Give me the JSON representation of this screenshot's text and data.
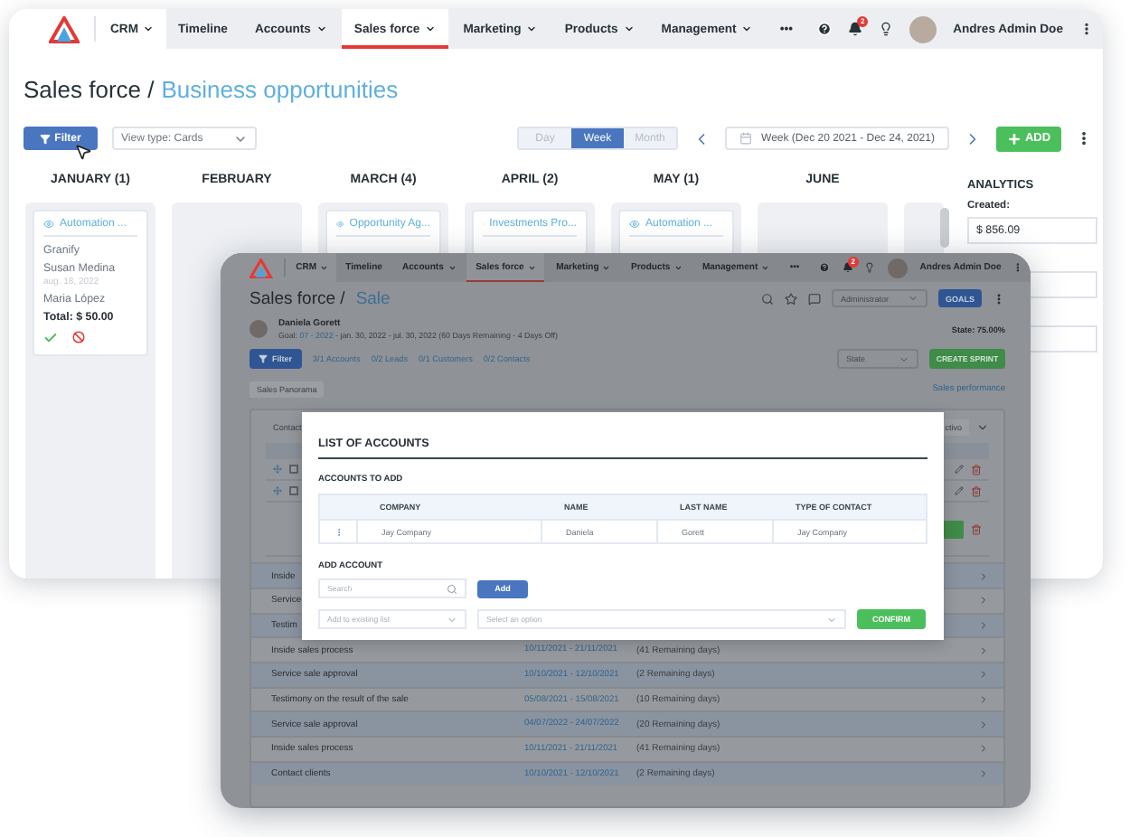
{
  "back_window": {
    "nav": {
      "menu": "CRM",
      "tabs": [
        {
          "label": "Timeline",
          "caret": false,
          "selected": false
        },
        {
          "label": "Accounts",
          "caret": true,
          "selected": false
        },
        {
          "label": "Sales force",
          "caret": true,
          "selected": true
        },
        {
          "label": "Marketing",
          "caret": true,
          "selected": false
        },
        {
          "label": "Products",
          "caret": true,
          "selected": false
        },
        {
          "label": "Management",
          "caret": true,
          "selected": false
        },
        {
          "label": "•••",
          "caret": false,
          "selected": false
        }
      ],
      "badge": "2",
      "user": "Andres Admin Doe"
    },
    "title": {
      "section": "Sales force /",
      "page": "Business opportunities"
    },
    "toolbar": {
      "filter": "Filter",
      "view_type": "View type: Cards",
      "ranges": [
        {
          "label": "Day",
          "selected": false
        },
        {
          "label": "Week",
          "selected": true
        },
        {
          "label": "Month",
          "selected": false
        }
      ],
      "date_range": "Week (Dec 20 2021 - Dec 24, 2021)",
      "add": "ADD"
    },
    "months": [
      {
        "header": "JANUARY (1)",
        "cards": [
          {
            "title": "Automation ...",
            "lines": [
              {
                "kind": "company",
                "text": "Granify"
              },
              {
                "kind": "contact",
                "text": "Susan Medina"
              },
              {
                "kind": "date",
                "text": "aug. 18, 2022"
              },
              {
                "kind": "contact",
                "text": "Maria López"
              },
              {
                "kind": "total",
                "text": "Total: $ 50.00"
              }
            ],
            "actions": true
          }
        ]
      },
      {
        "header": "FEBRUARY"
      },
      {
        "header": "MARCH (4)",
        "cards": [
          {
            "title": "Opportunity Ag...",
            "actions": false
          }
        ]
      },
      {
        "header": "APRIL (2)",
        "cards": [
          {
            "title": "Investments Pro...",
            "actions": false
          }
        ]
      },
      {
        "header": "MAY (1)",
        "cards": [
          {
            "title": "Automation ...",
            "actions": false
          }
        ]
      },
      {
        "header": "JUNE"
      }
    ],
    "analytics": {
      "title": "ANALYTICS",
      "created_label": "Created:",
      "created_value": "$ 856.09"
    }
  },
  "front_window": {
    "nav": {
      "menu": "CRM",
      "tabs": [
        {
          "label": "Timeline",
          "caret": false,
          "selected": false
        },
        {
          "label": "Accounts",
          "caret": true,
          "selected": false
        },
        {
          "label": "Sales force",
          "caret": true,
          "selected": true
        },
        {
          "label": "Marketing",
          "caret": true,
          "selected": false
        },
        {
          "label": "Products",
          "caret": true,
          "selected": false
        },
        {
          "label": "Management",
          "caret": true,
          "selected": false
        },
        {
          "label": "•••",
          "caret": false,
          "selected": false
        }
      ],
      "badge": "2",
      "user": "Andres Admin Doe"
    },
    "title": {
      "section": "Sales force /",
      "page": "Sale"
    },
    "role_select": "Administrator",
    "goals": "GOALS",
    "owner": {
      "name": "Daniela Gorett",
      "goal_label": "Goal:",
      "goal_link": "07 - 2022",
      "goal_rest": "- jan. 30, 2022 - jul. 30, 2022  (60 Days Remaining - 4 Days Off)"
    },
    "state": "State: 75.00%",
    "filter": "Filter",
    "counters": [
      "3/1 Accounts",
      "0/2 Leads",
      "0/1 Customers",
      "0/2 Contacts"
    ],
    "state_select": "State",
    "create_sprint": "CREATE SPRINT",
    "chip": "Sales Panorama",
    "performance_link": "Sales performance",
    "panel": {
      "header_label": "Contact",
      "status_chip": "ctivo",
      "inner_rows": [
        {
          "checked": false
        },
        {
          "checked": false
        }
      ]
    },
    "sprints": [
      {
        "name": "Inside"
      },
      {
        "name": "Service"
      },
      {
        "name": "Testim"
      },
      {
        "name": "Inside sales process",
        "dates": "10/11/2021 - 21/11/2021",
        "remaining": "(41 Remaining days)"
      },
      {
        "name": "Service sale approval",
        "dates": "10/10/2021 - 12/10/2021",
        "remaining": "(2 Remaining days)"
      },
      {
        "name": "Testimony on the result of the sale",
        "dates": "05/08/2021 - 15/08/2021",
        "remaining": "(10 Remaining days)"
      },
      {
        "name": "Service sale approval",
        "dates": "04/07/2022 - 24/07/2022",
        "remaining": "(20 Remaining days)"
      },
      {
        "name": "Inside sales process",
        "dates": "10/11/2021 - 21/11/2021",
        "remaining": "(41 Remaining days)"
      },
      {
        "name": "Contact clients",
        "dates": "10/10/2021 - 12/10/2021",
        "remaining": "(2 Remaining days)"
      }
    ],
    "modal": {
      "title": "LIST OF ACCOUNTS",
      "subtitle": "ACCOUNTS TO ADD",
      "columns": [
        "COMPANY",
        "NAME",
        "LAST NAME",
        "TYPE OF CONTACT"
      ],
      "rows": [
        [
          "Jay Company",
          "Daniela",
          "Gorett",
          "Jay Company"
        ]
      ],
      "add_title": "ADD ACCOUNT",
      "search_placeholder": "Search",
      "add": "Add",
      "list_placeholder": "Add to existing list",
      "option_placeholder": "Select an option",
      "confirm": "CONFIRM"
    }
  }
}
